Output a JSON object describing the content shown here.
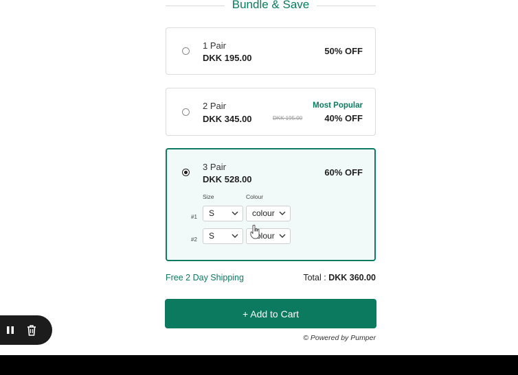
{
  "header": {
    "title": "Bundle & Save"
  },
  "options": [
    {
      "pair": "1 Pair",
      "price": "DKK 195.00",
      "discount": "50% OFF",
      "badge": "",
      "compare_price": "",
      "selected": false
    },
    {
      "pair": "2 Pair",
      "price": "DKK 345.00",
      "discount": "40% OFF",
      "badge": "Most Popular",
      "compare_price": "DKK 195.00",
      "selected": false
    },
    {
      "pair": "3 Pair",
      "price": "DKK 528.00",
      "discount": "60% OFF",
      "badge": "",
      "compare_price": "",
      "selected": true
    }
  ],
  "variant_picker": {
    "size_label": "Size",
    "colour_label": "Colour",
    "rows": [
      {
        "number": "#1",
        "size": "S",
        "colour": "colour"
      },
      {
        "number": "#2",
        "size": "S",
        "colour": "colour"
      }
    ]
  },
  "summary": {
    "shipping": "Free 2 Day Shipping",
    "total_label": "Total :",
    "total_value": "DKK 360.00"
  },
  "cart_button": {
    "label": "+ Add to Cart"
  },
  "powered_by": "© Powered by Pumper",
  "toolbar": {
    "icons": [
      "pause-icon",
      "trash-icon"
    ]
  },
  "colors": {
    "accent": "#0b7a5f",
    "selected_bg": "#f1faf8",
    "border": "#dcdcdc"
  }
}
